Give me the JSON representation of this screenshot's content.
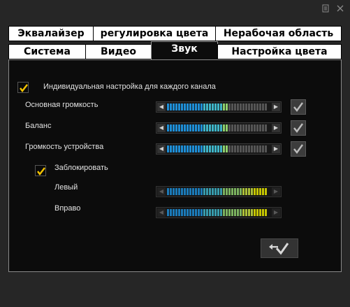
{
  "colors": {
    "background": "#262626",
    "panel": "#0c0c0c",
    "check": "#f5c400",
    "level_low": "#1e8ed6",
    "level_mid": "#8fd06e",
    "level_high": "#e6e600",
    "inactive": "#555555"
  },
  "window": {
    "icons": [
      "menu-icon",
      "close-icon"
    ]
  },
  "tabs_row1": [
    {
      "label": "Эквалайзер"
    },
    {
      "label": "регулировка цвета"
    },
    {
      "label": "Нерабочая область"
    }
  ],
  "tabs_row2": [
    {
      "label": "Система"
    },
    {
      "label": "Видео"
    },
    {
      "label": "Звук",
      "active": true
    },
    {
      "label": "Настройка цвета"
    }
  ],
  "sound": {
    "per_channel": {
      "label": "Индивидуальная настройка для каждого канала",
      "checked": true
    },
    "rows": [
      {
        "label": "Основная громкость",
        "level": 0.62,
        "enabled": true
      },
      {
        "label": "Баланс",
        "level": 0.62,
        "enabled": true
      },
      {
        "label": "Громкость устройства",
        "level": 0.62,
        "enabled": true
      }
    ],
    "lock": {
      "label": "Заблокировать",
      "checked": true
    },
    "channels": [
      {
        "label": "Левый",
        "level": 1.0
      },
      {
        "label": "Вправо",
        "level": 1.0
      }
    ],
    "apply_icon": "apply-arrow-check-icon"
  }
}
